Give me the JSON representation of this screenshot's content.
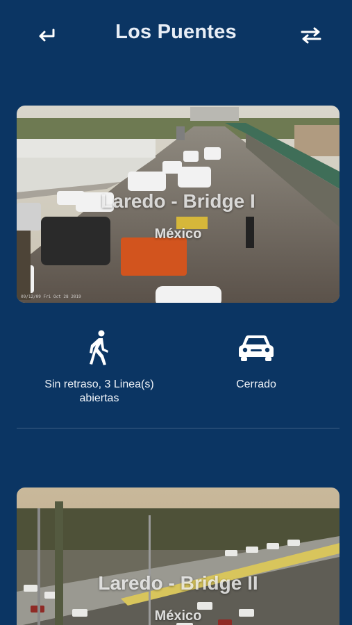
{
  "app_bar": {
    "title": "Los Puentes",
    "back_icon": "back-arrow-icon",
    "swap_icon": "swap-icon"
  },
  "bridges": [
    {
      "name": "Laredo - Bridge I",
      "country": "México",
      "camera_timestamp": "09/12/09 Fri Oct 28 2019",
      "pedestrian": {
        "icon": "pedestrian-icon",
        "status": "Sin retraso, 3 Linea(s) abiertas"
      },
      "vehicle": {
        "icon": "car-icon",
        "status": "Cerrado"
      }
    },
    {
      "name": "Laredo - Bridge II",
      "country": "México"
    }
  ],
  "colors": {
    "background": "#0b3563",
    "text": "#ffffff"
  }
}
